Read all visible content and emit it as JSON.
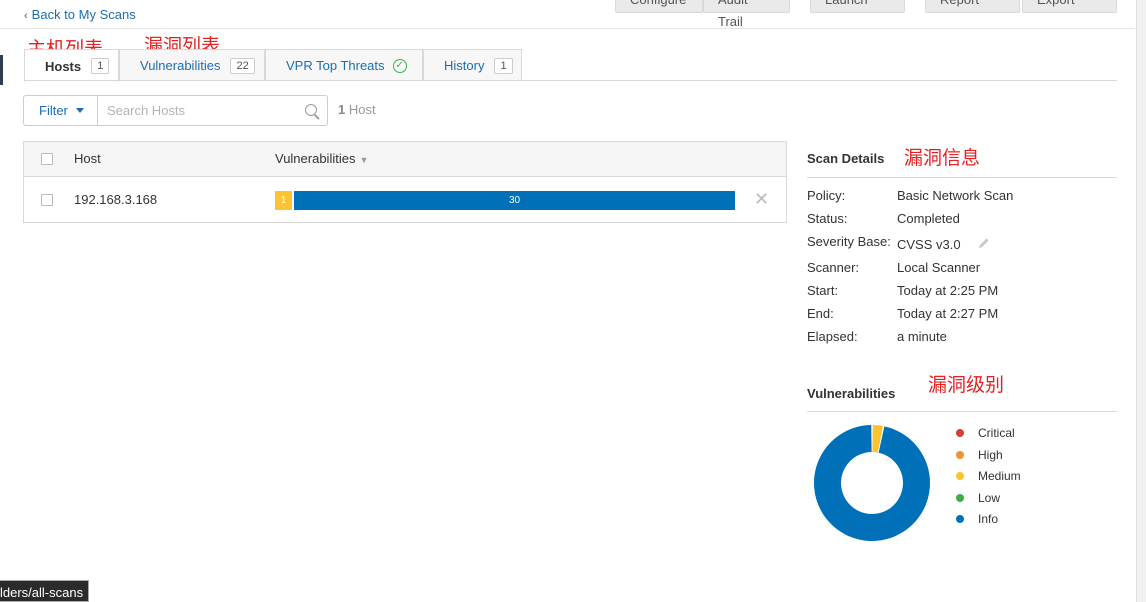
{
  "nav": {
    "back_label": "Back to My Scans"
  },
  "toolbar": {
    "buttons": [
      "Configure",
      "Audit Trail",
      "Launch",
      "Report",
      "Export"
    ]
  },
  "annotations": {
    "hosts_list": "主机列表",
    "vuln_list": "漏洞列表",
    "vuln_info": "漏洞信息",
    "vuln_level": "漏洞级别"
  },
  "tabs": [
    {
      "label": "Hosts",
      "count": "1",
      "active": true
    },
    {
      "label": "Vulnerabilities",
      "count": "22"
    },
    {
      "label": "VPR Top Threats"
    },
    {
      "label": "History",
      "count": "1"
    }
  ],
  "filter": {
    "label": "Filter",
    "search_placeholder": "Search Hosts",
    "host_count_num": "1",
    "host_count_label": "Host"
  },
  "table": {
    "headers": {
      "host": "Host",
      "vulnerabilities": "Vulnerabilities"
    },
    "rows": [
      {
        "host": "192.168.3.168",
        "medium": "1",
        "info": "30"
      }
    ]
  },
  "scan_details": {
    "title": "Scan Details",
    "fields": [
      {
        "label": "Policy:",
        "value": "Basic Network Scan"
      },
      {
        "label": "Status:",
        "value": "Completed"
      },
      {
        "label": "Severity Base:",
        "value": "CVSS v3.0"
      },
      {
        "label": "Scanner:",
        "value": "Local Scanner"
      },
      {
        "label": "Start:",
        "value": "Today at 2:25 PM"
      },
      {
        "label": "End:",
        "value": "Today at 2:27 PM"
      },
      {
        "label": "Elapsed:",
        "value": "a minute"
      }
    ]
  },
  "vulnerabilities_chart": {
    "title": "Vulnerabilities",
    "legend": [
      "Critical",
      "High",
      "Medium",
      "Low",
      "Info"
    ]
  },
  "chart_data": {
    "type": "pie",
    "categories": [
      "Critical",
      "High",
      "Medium",
      "Low",
      "Info"
    ],
    "values": [
      0,
      0,
      1,
      0,
      30
    ],
    "colors": [
      "#d43f3a",
      "#ee9336",
      "#fdc431",
      "#3fae49",
      "#0071b9"
    ]
  },
  "status_bar": {
    "url": "lders/all-scans"
  }
}
